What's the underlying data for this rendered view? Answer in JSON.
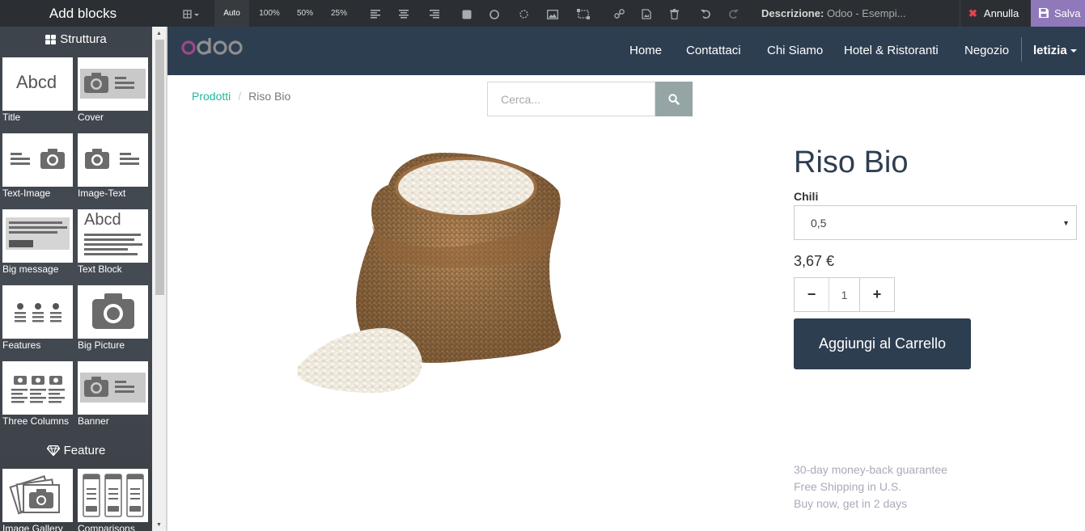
{
  "editor": {
    "sidebar_title": "Add blocks",
    "zoom_options": [
      "Auto",
      "100%",
      "50%",
      "25%"
    ],
    "description_label": "Descrizione:",
    "description_value": "Odoo - Esempi...",
    "cancel_label": "Annulla",
    "save_label": "Salva"
  },
  "sidebar": {
    "sections": [
      {
        "title": "Struttura",
        "blocks": [
          "Title",
          "Cover",
          "Text-Image",
          "Image-Text",
          "Big message",
          "Text Block",
          "Features",
          "Big Picture",
          "Three Columns",
          "Banner"
        ]
      },
      {
        "title": "Feature",
        "blocks": [
          "Image Gallery",
          "Comparisons"
        ]
      }
    ],
    "title_thumb_text": "Abcd"
  },
  "navbar": {
    "logo": "odoo",
    "links": [
      "Home",
      "Contattaci",
      "Chi Siamo",
      "Hotel & Ristoranti",
      "Negozio"
    ],
    "user": "letizia"
  },
  "breadcrumb": {
    "parent": "Prodotti",
    "separator": "/",
    "current": "Riso Bio"
  },
  "search": {
    "placeholder": "Cerca..."
  },
  "product": {
    "name": "Riso Bio",
    "attribute_label": "Chili",
    "attribute_value": "0,5",
    "price": "3,67 €",
    "quantity": "1",
    "add_to_cart": "Aggiungi al Carrello",
    "guarantees": [
      "30-day money-back guarantee",
      "Free Shipping in U.S.",
      "Buy now, get in 2 days"
    ]
  },
  "colors": {
    "navbar": "#2e3e51",
    "accent_link": "#21b799",
    "save_button": "#8f79ba",
    "cancel_icon": "#e0474c",
    "logo_o": "#a24689"
  }
}
